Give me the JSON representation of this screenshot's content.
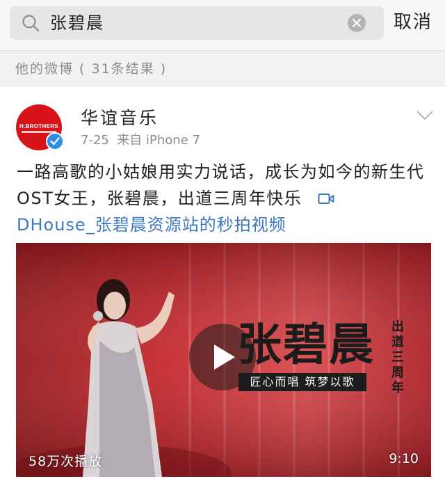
{
  "search": {
    "query": "张碧晨",
    "cancel_label": "取消"
  },
  "section": {
    "title": "他的微博 ( 31条结果 )"
  },
  "post": {
    "author": "华谊音乐",
    "avatar_brand": "H.BROTHERS",
    "date": "7-25",
    "source": "来自 iPhone 7",
    "text": "一路高歌的小姑娘用实力说话，成长为如今的新生代OST女王，张碧晨，出道三周年快乐",
    "link_text": "DHouse_张碧晨资源站的秒拍视频",
    "video": {
      "title": "张碧晨",
      "subtitle": "匠心而唱 筑梦以歌",
      "side_text": "出道三周年",
      "views": "58万次播放",
      "duration": "9:10"
    }
  },
  "colors": {
    "link": "#3e78c3",
    "avatar_bg": "#d8141b",
    "verified": "#2b8ee8"
  }
}
